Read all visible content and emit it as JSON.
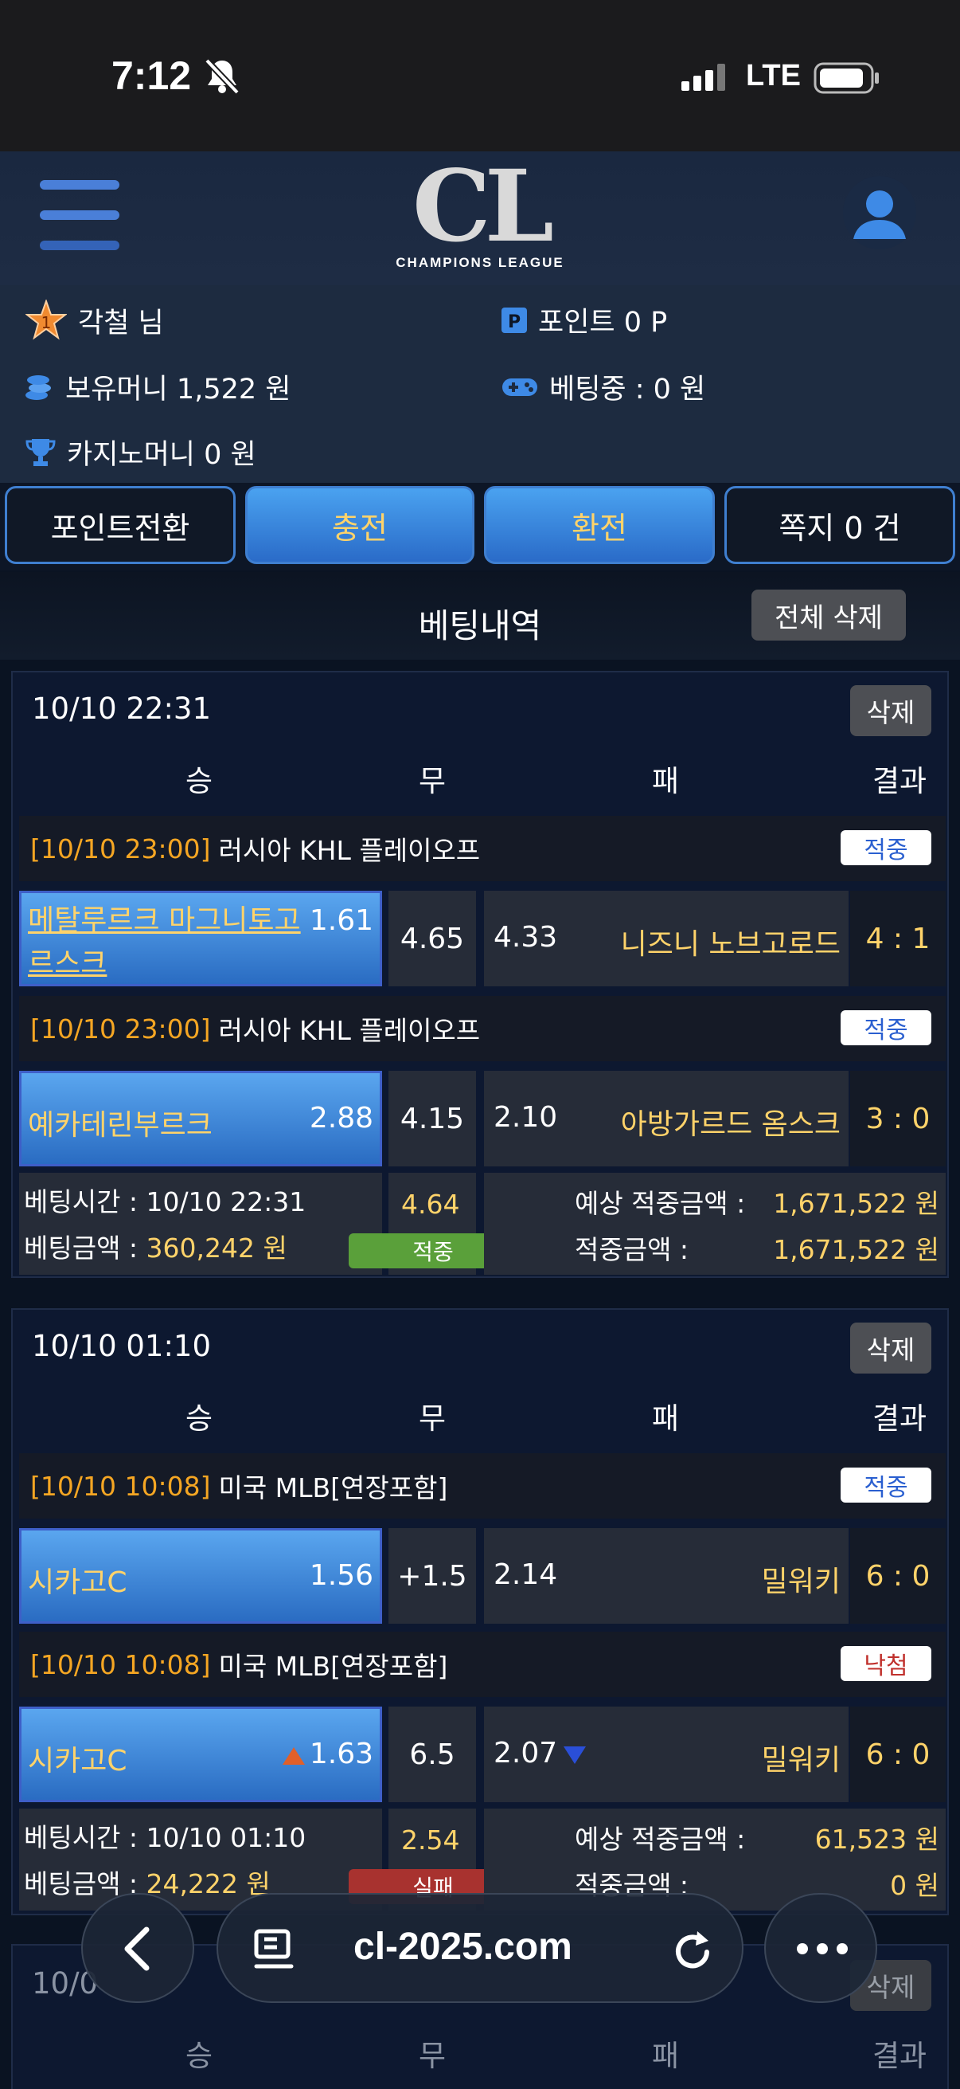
{
  "status": {
    "time": "7:12",
    "network": "LTE"
  },
  "header": {
    "logo_main": "CL",
    "logo_sub": "CHAMPIONS LEAGUE"
  },
  "user": {
    "rank_badge": "1",
    "name": "각철 님",
    "point": "포인트 0 P",
    "money": "보유머니 1,522 원",
    "betting": "베팅중 : 0 원",
    "casino": "카지노머니 0 원"
  },
  "buttons": {
    "point_convert": "포인트전환",
    "deposit": "충전",
    "withdraw": "환전",
    "messages": "쪽지 0 건"
  },
  "section": {
    "title": "베팅내역",
    "delete_all": "전체 삭제"
  },
  "columns": {
    "win": "승",
    "draw": "무",
    "lose": "패",
    "result": "결과"
  },
  "bets": [
    {
      "datetime": "10/10 22:31",
      "delete": "삭제",
      "games": [
        {
          "date": "[10/10 23:00]",
          "league": "러시아 KHL 플레이오프",
          "status": "적중",
          "home": "메탈루르크 마그니토고르스크",
          "home_odds": "1.61",
          "draw": "4.65",
          "away_odds": "4.33",
          "away": "니즈니 노브고로드",
          "score": "4 : 1"
        },
        {
          "date": "[10/10 23:00]",
          "league": "러시아 KHL 플레이오프",
          "status": "적중",
          "home": "예카테린부르크",
          "home_odds": "2.88",
          "draw": "4.15",
          "away_odds": "2.10",
          "away": "아방가르드 옴스크",
          "score": "3 : 0"
        }
      ],
      "summary": {
        "time_label": "베팅시간 : 10/10 22:31",
        "amount_label": "베팅금액 : ",
        "amount": "360,242 원",
        "total_odds": "4.64",
        "result": "적중",
        "expected_label": "예상 적중금액 :",
        "expected": "1,671,522 원",
        "win_label": "적중금액 :",
        "win": "1,671,522 원"
      }
    },
    {
      "datetime": "10/10 01:10",
      "delete": "삭제",
      "games": [
        {
          "date": "[10/10 10:08]",
          "league": "미국 MLB[연장포함]",
          "status": "적중",
          "home": "시카고C",
          "home_odds": "1.56",
          "draw": "+1.5",
          "away_odds": "2.14",
          "away": "밀워키",
          "score": "6 : 0"
        },
        {
          "date": "[10/10 10:08]",
          "league": "미국 MLB[연장포함]",
          "status": "낙첨",
          "home": "시카고C",
          "home_odds": "1.63",
          "draw": "6.5",
          "away_odds": "2.07",
          "away": "밀워키",
          "score": "6 : 0"
        }
      ],
      "summary": {
        "time_label": "베팅시간 : 10/10 01:10",
        "amount_label": "베팅금액 : ",
        "amount": "24,222 원",
        "total_odds": "2.54",
        "result": "실패",
        "expected_label": "예상 적중금액 :",
        "expected": "61,523 원",
        "win_label": "적중금액 :",
        "win": "0 원"
      }
    },
    {
      "datetime": "10/0",
      "delete": "삭제"
    }
  ],
  "browser": {
    "url": "cl-2025.com"
  },
  "colors": {
    "accent_blue": "#3a8be0",
    "odds_yellow": "#ffd36a",
    "win_green": "#5aa03a",
    "lose_red": "#a8322f"
  }
}
